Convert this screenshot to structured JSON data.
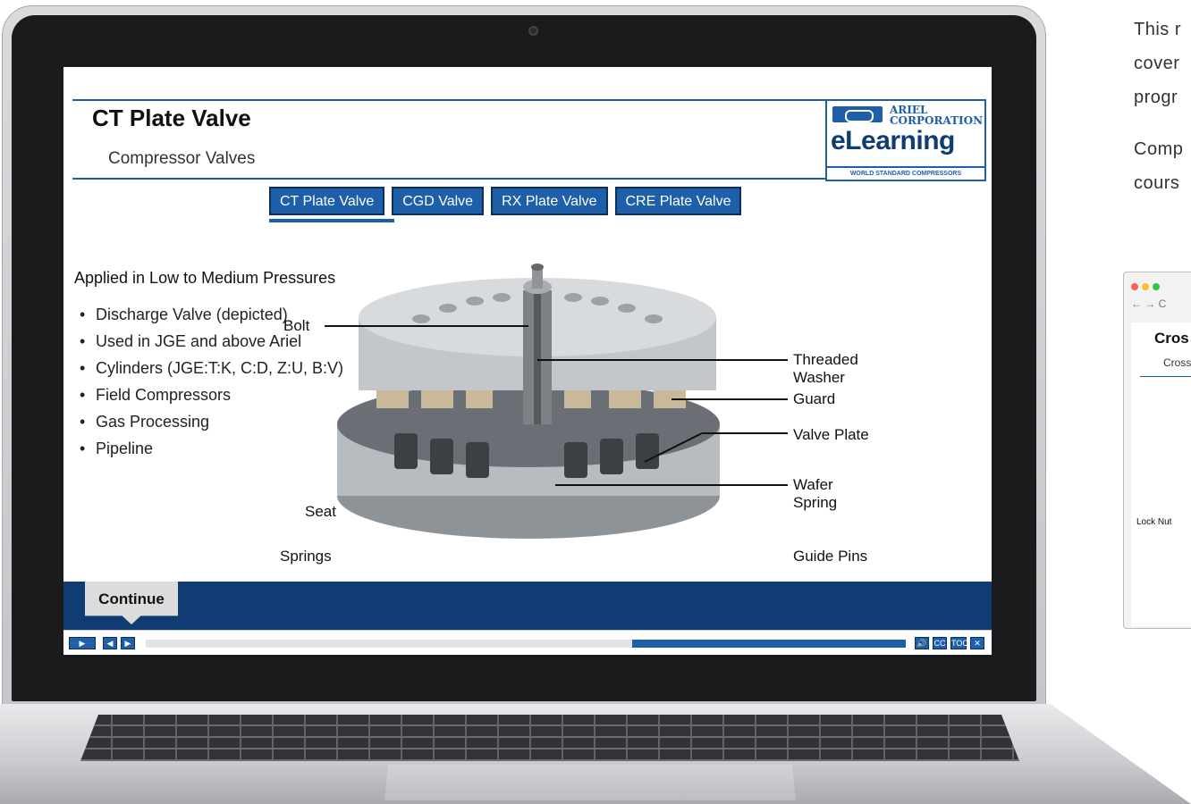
{
  "course": {
    "title": "CT Plate Valve",
    "subtitle": "Compressor Valves",
    "logo": {
      "company": "ARIEL CORPORATION",
      "product": "eLearning",
      "tagline": "WORLD STANDARD COMPRESSORS"
    },
    "tabs": [
      {
        "label": "CT Plate Valve",
        "active": true
      },
      {
        "label": "CGD Valve",
        "active": false
      },
      {
        "label": "RX Plate Valve",
        "active": false
      },
      {
        "label": "CRE Plate Valve",
        "active": false
      }
    ],
    "application_heading": "Applied in Low to Medium Pressures",
    "bullets": [
      "Discharge Valve (depicted)",
      "Used in JGE and above Ariel",
      "Cylinders (JGE:T:K, C:D, Z:U, B:V)",
      "Field Compressors",
      "Gas Processing",
      "Pipeline"
    ],
    "diagram_labels": {
      "bolt": "Bolt",
      "threaded_washer": "Threaded Washer",
      "guard": "Guard",
      "valve_plate": "Valve Plate",
      "wafer_spring": "Wafer Spring",
      "seat": "Seat",
      "springs": "Springs",
      "guide_pins": "Guide Pins"
    },
    "continue_label": "Continue",
    "player": {
      "progress": 0.36,
      "buttons": {
        "play": "▶",
        "prev": "◀",
        "next": "▶",
        "volume": "🔊",
        "cc": "CC",
        "toc": "TOC",
        "close": "✕"
      }
    }
  },
  "side_text": [
    "This r",
    "cover",
    "progr",
    "Comp",
    "cours"
  ],
  "browser_preview": {
    "nav": "← → C",
    "title": "Cros",
    "subtitle": "Cross",
    "callout": "Lock Nut"
  },
  "colors": {
    "brand_blue": "#1d5fa8",
    "dark_navy": "#0f3c72",
    "bezel": "#1b1b1d"
  }
}
